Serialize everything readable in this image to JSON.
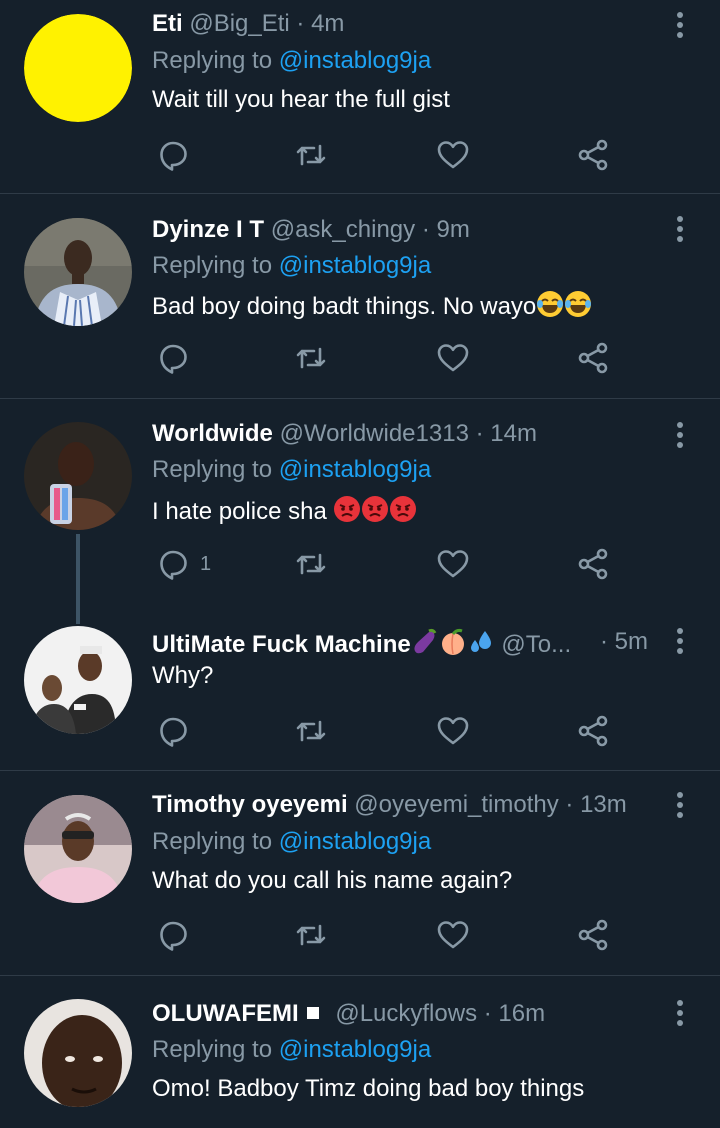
{
  "tweets": [
    {
      "name": "Eti",
      "handle": "@Big_Eti",
      "time": "· 4m",
      "replying_prefix": "Replying to ",
      "replying_to": "@instablog9ja",
      "text": "Wait till you hear the full gist",
      "reply_count": ""
    },
    {
      "name": "Dyinze I T",
      "handle": "@ask_chingy",
      "time": "· 9m",
      "replying_prefix": "Replying to ",
      "replying_to": "@instablog9ja",
      "text": "Bad boy doing badt things. No wayo",
      "reply_count": ""
    },
    {
      "name": "Worldwide",
      "handle": "@Worldwide1313",
      "time": "· 14m",
      "replying_prefix": "Replying to ",
      "replying_to": "@instablog9ja",
      "text": "I hate police sha ",
      "reply_count": "1"
    },
    {
      "name": "UltiMate Fuck Machine",
      "handle": "@To...",
      "time": "· 5m",
      "text": "Why?",
      "reply_count": ""
    },
    {
      "name": "Timothy oyeyemi",
      "handle": "@oyeyemi_timothy",
      "time": "· 13m",
      "replying_prefix": "Replying to ",
      "replying_to": "@instablog9ja",
      "text": "What do you call his name again?",
      "reply_count": ""
    },
    {
      "name": "OLUWAFEMI",
      "handle": "@Luckyflows",
      "time": "· 16m",
      "replying_prefix": "Replying to ",
      "replying_to": "@instablog9ja",
      "text": "Omo! Badboy Timz doing bad boy things"
    }
  ],
  "icons": {
    "reply": "reply-icon",
    "retweet": "retweet-icon",
    "like": "heart-icon",
    "share": "share-icon",
    "more": "more-vertical-icon"
  },
  "colors": {
    "background": "#15202b",
    "secondary_text": "#8899a6",
    "link": "#1da1f2",
    "divider": "#2f3b47"
  }
}
